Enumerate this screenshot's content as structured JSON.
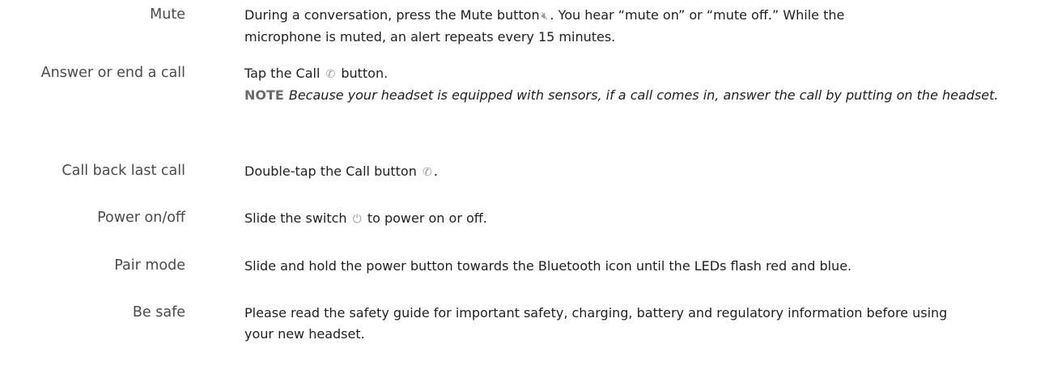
{
  "rows": [
    {
      "term": "Mute",
      "desc_a": "During a conversation, press the Mute button",
      "icon": "mute-icon",
      "desc_b": ". You hear “mute on” or “mute off.” While the",
      "desc_c": "microphone is muted, an alert repeats every 15 minutes."
    },
    {
      "term": "Answer or end a call",
      "desc_a": "Tap the Call",
      "icon": "phone-icon",
      "desc_b": "button.",
      "note_label": "NOTE",
      "note_text": "Because your headset is equipped with sensors, if a call comes in, answer the call by putting on the headset."
    },
    {
      "term": "Call back last call",
      "desc_a": "Double-tap the Call button",
      "icon": "phone-icon",
      "desc_b": "."
    },
    {
      "term": "Power on/off",
      "desc_a": "Slide the switch",
      "icon": "power-icon",
      "desc_b": "to power on or off."
    },
    {
      "term": "Pair mode",
      "desc_a": "Slide and hold the power button towards the Bluetooth icon until the LEDs flash red and blue."
    },
    {
      "term": "Be safe",
      "desc_a": "Please read the safety guide for important safety, charging, battery and regulatory information before using your new headset."
    }
  ]
}
